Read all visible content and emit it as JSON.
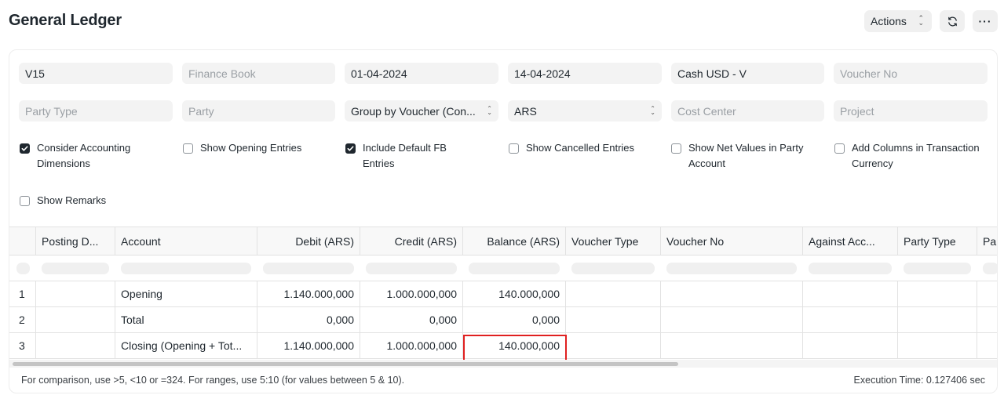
{
  "page": {
    "title": "General Ledger",
    "actions_label": "Actions",
    "more_label": "···"
  },
  "filters": {
    "row1": [
      {
        "key": "company",
        "value": "V15",
        "placeholder": ""
      },
      {
        "key": "finance_book",
        "value": "",
        "placeholder": "Finance Book"
      },
      {
        "key": "from_date",
        "value": "01-04-2024",
        "placeholder": ""
      },
      {
        "key": "to_date",
        "value": "14-04-2024",
        "placeholder": ""
      },
      {
        "key": "account",
        "value": "Cash USD - V",
        "placeholder": ""
      },
      {
        "key": "voucher_no",
        "value": "",
        "placeholder": "Voucher No"
      }
    ],
    "row2": [
      {
        "key": "party_type",
        "value": "",
        "placeholder": "Party Type"
      },
      {
        "key": "party",
        "value": "",
        "placeholder": "Party"
      },
      {
        "key": "group_by",
        "value": "Group by Voucher (Con...",
        "placeholder": ""
      },
      {
        "key": "currency",
        "value": "ARS",
        "placeholder": ""
      },
      {
        "key": "cost_center",
        "value": "",
        "placeholder": "Cost Center"
      },
      {
        "key": "project",
        "value": "",
        "placeholder": "Project"
      }
    ],
    "checkboxes": [
      {
        "label": "Consider Accounting Dimensions",
        "checked": true
      },
      {
        "label": "Show Opening Entries",
        "checked": false
      },
      {
        "label": "Include Default FB Entries",
        "checked": true
      },
      {
        "label": "Show Cancelled Entries",
        "checked": false
      },
      {
        "label": "Show Net Values in Party Account",
        "checked": false
      },
      {
        "label": "Add Columns in Transaction Currency",
        "checked": false
      },
      {
        "label": "Show Remarks",
        "checked": false
      }
    ]
  },
  "table": {
    "columns": [
      "Posting D...",
      "Account",
      "Debit (ARS)",
      "Credit (ARS)",
      "Balance (ARS)",
      "Voucher Type",
      "Voucher No",
      "Against Acc...",
      "Party Type",
      "Pa"
    ],
    "rows": [
      {
        "num": "1",
        "account": "Opening",
        "debit": "1.140.000,000",
        "credit": "1.000.000,000",
        "balance": "140.000,000"
      },
      {
        "num": "2",
        "account": "Total",
        "debit": "0,000",
        "credit": "0,000",
        "balance": "0,000"
      },
      {
        "num": "3",
        "account": "Closing (Opening + Tot...",
        "debit": "1.140.000,000",
        "credit": "1.000.000,000",
        "balance": "140.000,000"
      }
    ]
  },
  "footer": {
    "hint": "For comparison, use >5, <10 or =324. For ranges, use 5:10 (for values between 5 & 10).",
    "execution_time": "Execution Time: 0.127406 sec"
  },
  "colors": {
    "highlight": "#e02020"
  }
}
